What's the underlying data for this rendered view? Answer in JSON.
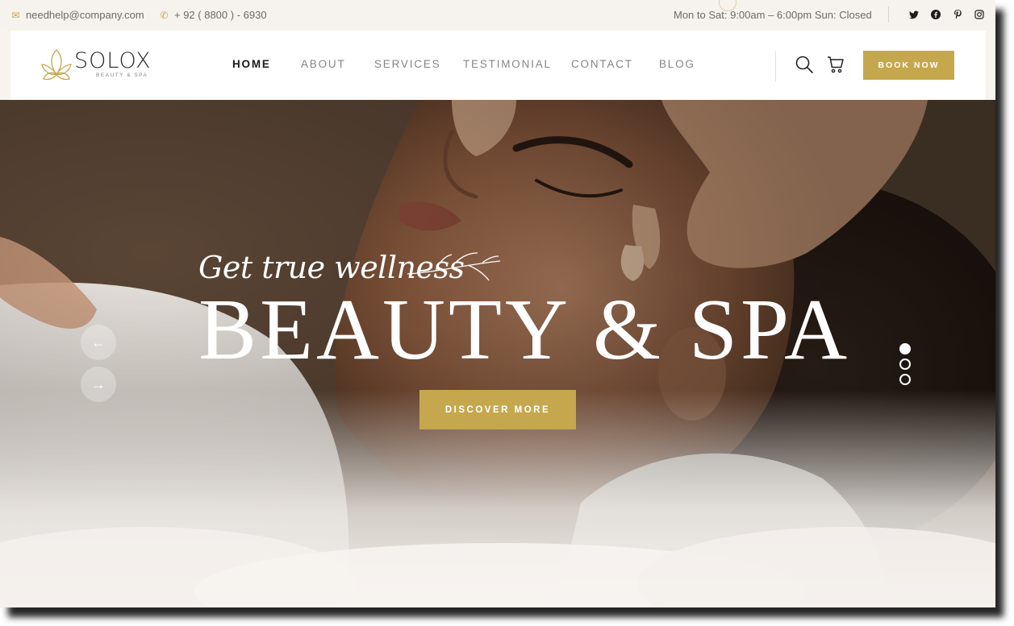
{
  "topbar": {
    "email": "needhelp@company.com",
    "phone": "+ 92 ( 8800 ) - 6930",
    "hours": "Mon to Sat: 9:00am – 6:00pm Sun: Closed",
    "email_icon": "envelope-icon",
    "phone_icon": "phone-icon",
    "socials": [
      "twitter-icon",
      "facebook-icon",
      "pinterest-icon",
      "instagram-icon"
    ]
  },
  "brand": {
    "name": "SOLOX",
    "tagline": "BEAUTY & SPA"
  },
  "nav": {
    "items": [
      {
        "label": "HOME",
        "active": true
      },
      {
        "label": "ABOUT",
        "active": false
      },
      {
        "label": "SERVICES",
        "active": false
      },
      {
        "label": "TESTIMONIAL",
        "active": false
      },
      {
        "label": "CONTACT",
        "active": false
      },
      {
        "label": "BLOG",
        "active": false
      }
    ],
    "book_label": "BOOK NOW"
  },
  "hero": {
    "tagline": "Get true wellness",
    "headline": "BEAUTY & SPA",
    "cta_label": "DISCOVER MORE",
    "prev_arrow": "←",
    "next_arrow": "→",
    "slides_count": 3,
    "active_slide": 1
  },
  "colors": {
    "accent": "#c5a84e",
    "text_dark": "#1a1a1a",
    "nav_muted": "#8a8580",
    "topbar_bg": "#f6f2ee"
  }
}
